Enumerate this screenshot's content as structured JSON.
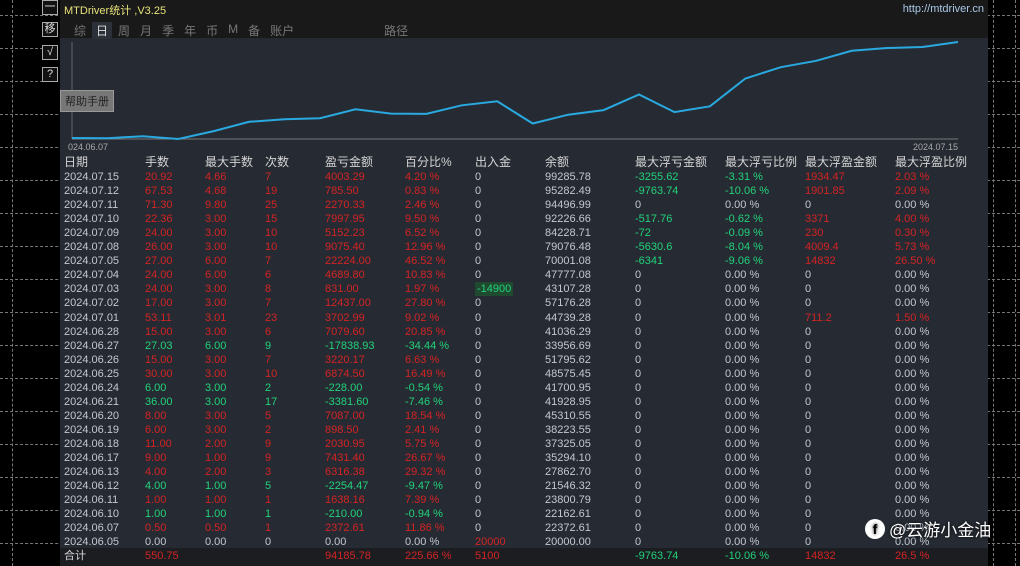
{
  "window": {
    "title": "MTDriver统计 ,V3.25",
    "url": "http://mtdriver.cn",
    "help_tooltip": "帮助手册"
  },
  "side_buttons": [
    "一",
    "移",
    "√",
    "?"
  ],
  "tabs": [
    {
      "label": "综"
    },
    {
      "label": "日",
      "active": true
    },
    {
      "label": "周"
    },
    {
      "label": "月"
    },
    {
      "label": "季"
    },
    {
      "label": "年"
    },
    {
      "label": "币"
    },
    {
      "label": "M"
    },
    {
      "label": "备"
    },
    {
      "label": "账户"
    },
    {
      "label": "路径"
    }
  ],
  "chart": {
    "start_label": "024.06.07",
    "end_label": "2024.07.15",
    "line_color": "#29a9e0"
  },
  "colors": {
    "up": "#d42323",
    "down": "#22d27a",
    "neutral": "#c3c8d0",
    "header": "#d4d4d4"
  },
  "table": {
    "headers": [
      "日期",
      "手数",
      "最大手数",
      "次数",
      "盈亏金额",
      "百分比%",
      "出入金",
      "余额",
      "最大浮亏金额",
      "最大浮亏比例",
      "最大浮盈金额",
      "最大浮盈比例"
    ],
    "rows": [
      [
        "2024.07.15",
        "20.92",
        "4.66",
        "7",
        "4003.29",
        "4.20 %",
        "0",
        "99285.78",
        "-3255.62",
        "-3.31 %",
        "1934.47",
        "2.03 %"
      ],
      [
        "2024.07.12",
        "67.53",
        "4.68",
        "19",
        "785.50",
        "0.83 %",
        "0",
        "95282.49",
        "-9763.74",
        "-10.06 %",
        "1901.85",
        "2.09 %"
      ],
      [
        "2024.07.11",
        "71.30",
        "9.80",
        "25",
        "2270.33",
        "2.46 %",
        "0",
        "94496.99",
        "0",
        "0.00 %",
        "0",
        "0.00 %"
      ],
      [
        "2024.07.10",
        "22.36",
        "3.00",
        "15",
        "7997.95",
        "9.50 %",
        "0",
        "92226.66",
        "-517.76",
        "-0.62 %",
        "3371",
        "4.00 %"
      ],
      [
        "2024.07.09",
        "24.00",
        "3.00",
        "10",
        "5152.23",
        "6.52 %",
        "0",
        "84228.71",
        "-72",
        "-0.09 %",
        "230",
        "0.30 %"
      ],
      [
        "2024.07.08",
        "26.00",
        "3.00",
        "10",
        "9075.40",
        "12.96 %",
        "0",
        "79076.48",
        "-5630.6",
        "-8.04 %",
        "4009.4",
        "5.73 %"
      ],
      [
        "2024.07.05",
        "27.00",
        "6.00",
        "7",
        "22224.00",
        "46.52 %",
        "0",
        "70001.08",
        "-6341",
        "-9.06 %",
        "14832",
        "26.50 %"
      ],
      [
        "2024.07.04",
        "24.00",
        "6.00",
        "6",
        "4689.80",
        "10.83 %",
        "0",
        "47777.08",
        "0",
        "0.00 %",
        "0",
        "0.00 %"
      ],
      [
        "2024.07.03",
        "24.00",
        "3.00",
        "8",
        "831.00",
        "1.97 %",
        "-14900",
        "43107.28",
        "0",
        "0.00 %",
        "0",
        "0.00 %"
      ],
      [
        "2024.07.02",
        "17.00",
        "3.00",
        "7",
        "12437.00",
        "27.80 %",
        "0",
        "57176.28",
        "0",
        "0.00 %",
        "0",
        "0.00 %"
      ],
      [
        "2024.07.01",
        "53.11",
        "3.01",
        "23",
        "3702.99",
        "9.02 %",
        "0",
        "44739.28",
        "0",
        "0.00 %",
        "711.2",
        "1.50 %"
      ],
      [
        "2024.06.28",
        "15.00",
        "3.00",
        "6",
        "7079.60",
        "20.85 %",
        "0",
        "41036.29",
        "0",
        "0.00 %",
        "0",
        "0.00 %"
      ],
      [
        "2024.06.27",
        "27.03",
        "6.00",
        "9",
        "-17838.93",
        "-34.44 %",
        "0",
        "33956.69",
        "0",
        "0.00 %",
        "0",
        "0.00 %"
      ],
      [
        "2024.06.26",
        "15.00",
        "3.00",
        "7",
        "3220.17",
        "6.63 %",
        "0",
        "51795.62",
        "0",
        "0.00 %",
        "0",
        "0.00 %"
      ],
      [
        "2024.06.25",
        "30.00",
        "3.00",
        "10",
        "6874.50",
        "16.49 %",
        "0",
        "48575.45",
        "0",
        "0.00 %",
        "0",
        "0.00 %"
      ],
      [
        "2024.06.24",
        "6.00",
        "3.00",
        "2",
        "-228.00",
        "-0.54 %",
        "0",
        "41700.95",
        "0",
        "0.00 %",
        "0",
        "0.00 %"
      ],
      [
        "2024.06.21",
        "36.00",
        "3.00",
        "17",
        "-3381.60",
        "-7.46 %",
        "0",
        "41928.95",
        "0",
        "0.00 %",
        "0",
        "0.00 %"
      ],
      [
        "2024.06.20",
        "8.00",
        "3.00",
        "5",
        "7087.00",
        "18.54 %",
        "0",
        "45310.55",
        "0",
        "0.00 %",
        "0",
        "0.00 %"
      ],
      [
        "2024.06.19",
        "6.00",
        "3.00",
        "2",
        "898.50",
        "2.41 %",
        "0",
        "38223.55",
        "0",
        "0.00 %",
        "0",
        "0.00 %"
      ],
      [
        "2024.06.18",
        "11.00",
        "2.00",
        "9",
        "2030.95",
        "5.75 %",
        "0",
        "37325.05",
        "0",
        "0.00 %",
        "0",
        "0.00 %"
      ],
      [
        "2024.06.17",
        "9.00",
        "1.00",
        "9",
        "7431.40",
        "26.67 %",
        "0",
        "35294.10",
        "0",
        "0.00 %",
        "0",
        "0.00 %"
      ],
      [
        "2024.06.13",
        "4.00",
        "2.00",
        "3",
        "6316.38",
        "29.32 %",
        "0",
        "27862.70",
        "0",
        "0.00 %",
        "0",
        "0.00 %"
      ],
      [
        "2024.06.12",
        "4.00",
        "1.00",
        "5",
        "-2254.47",
        "-9.47 %",
        "0",
        "21546.32",
        "0",
        "0.00 %",
        "0",
        "0.00 %"
      ],
      [
        "2024.06.11",
        "1.00",
        "1.00",
        "1",
        "1638.16",
        "7.39 %",
        "0",
        "23800.79",
        "0",
        "0.00 %",
        "0",
        "0.00 %"
      ],
      [
        "2024.06.10",
        "1.00",
        "1.00",
        "1",
        "-210.00",
        "-0.94 %",
        "0",
        "22162.61",
        "0",
        "0.00 %",
        "0",
        "0.00 %"
      ],
      [
        "2024.06.07",
        "0.50",
        "0.50",
        "1",
        "2372.61",
        "11.86 %",
        "0",
        "22372.61",
        "0",
        "0.00 %",
        "0",
        "0.00 %"
      ],
      [
        "2024.06.05",
        "0.00",
        "0.00",
        "0",
        "0.00",
        "0.00 %",
        "20000",
        "20000.00",
        "0",
        "0.00 %",
        "0",
        "0.00 %"
      ]
    ],
    "footer": [
      "合计",
      "550.75",
      "",
      "",
      "94185.78",
      "225.66 %",
      "5100",
      "",
      "-9763.74",
      "-10.06 %",
      "14832",
      "26.5 %"
    ]
  },
  "watermark": "@云游小金油"
}
